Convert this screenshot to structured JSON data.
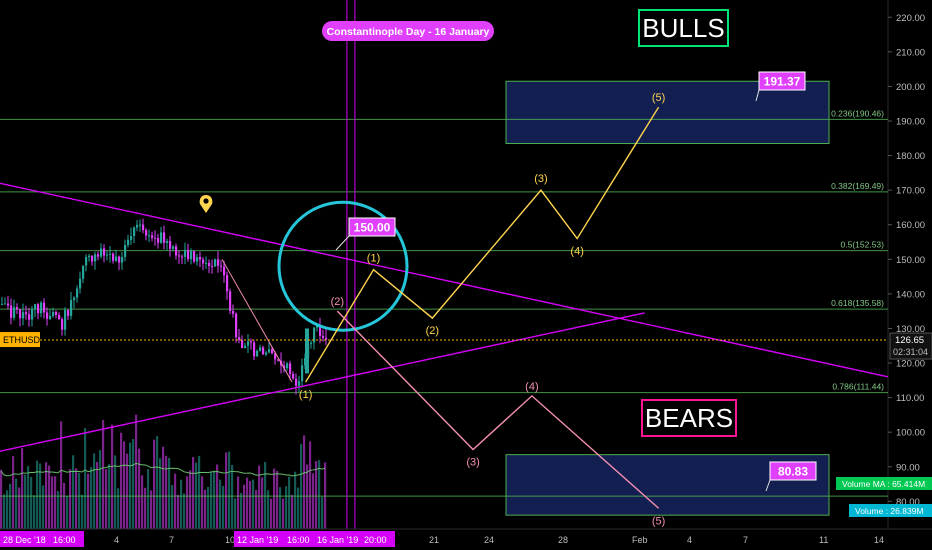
{
  "chart_data": {
    "type": "candlestick",
    "symbol": "ETHUSD",
    "y_axis": {
      "min": 72,
      "max": 225,
      "ticks": [
        80,
        90,
        100,
        110,
        120,
        130,
        140,
        150,
        160,
        170,
        180,
        190,
        200,
        210,
        220
      ],
      "tick_labels": [
        "80.00",
        "90.00",
        "100.00",
        "110.00",
        "120.00",
        "130.00",
        "140.00",
        "150.00",
        "160.00",
        "170.00",
        "180.00",
        "190.00",
        "200.00",
        "210.00",
        "220.00"
      ]
    },
    "x_axis": {
      "labels": [
        {
          "text": "28 Dec '18",
          "at": "2018-12-28",
          "highlight": true
        },
        {
          "text": "16:00",
          "at": "2018-12-28T16:00",
          "highlight": true
        },
        {
          "text": "4",
          "at": "2019-01-04",
          "highlight": false
        },
        {
          "text": "7",
          "at": "2019-01-07",
          "highlight": false
        },
        {
          "text": "10",
          "at": "2019-01-10",
          "highlight": false
        },
        {
          "text": "12 Jan '19",
          "at": "2019-01-12",
          "highlight": true
        },
        {
          "text": "16:00",
          "at": "2019-01-13T16:00",
          "highlight": true
        },
        {
          "text": "16 Jan '19",
          "at": "2019-01-16",
          "highlight": true
        },
        {
          "text": "20:00",
          "at": "2019-01-16T20:00",
          "highlight": true
        },
        {
          "text": "21",
          "at": "2019-01-21",
          "highlight": false
        },
        {
          "text": "24",
          "at": "2019-01-24",
          "highlight": false
        },
        {
          "text": "28",
          "at": "2019-01-28",
          "highlight": false
        },
        {
          "text": "Feb",
          "at": "2019-02-01",
          "highlight": false
        },
        {
          "text": "4",
          "at": "2019-02-04",
          "highlight": false
        },
        {
          "text": "7",
          "at": "2019-02-07",
          "highlight": false
        },
        {
          "text": "11",
          "at": "2019-02-11",
          "highlight": false
        },
        {
          "text": "14",
          "at": "2019-02-14",
          "highlight": false
        }
      ]
    },
    "fib_levels": [
      {
        "label": "0.236(190.46)",
        "value": 190.46
      },
      {
        "label": "0.382(169.49)",
        "value": 169.49
      },
      {
        "label": "0.5(152.53)",
        "value": 152.53
      },
      {
        "label": "0.618(135.58)",
        "value": 135.58
      },
      {
        "label": "0.786(111.44)",
        "value": 111.44
      },
      {
        "label": "",
        "value": 81.5
      }
    ],
    "current_price": {
      "value": 126.65,
      "label": "126.65",
      "countdown": "02:31:04"
    },
    "event": {
      "label": "Constantinople Day - 16 January",
      "at": "2019-01-16"
    },
    "targets": [
      {
        "label": "150.00",
        "value": 150.0
      },
      {
        "label": "191.37",
        "value": 191.37
      },
      {
        "label": "80.83",
        "value": 80.83
      }
    ],
    "scenario_labels": {
      "bull": "BULLS",
      "bear": "BEARS"
    },
    "bull_path": [
      {
        "at": "2019-01-13T12:00",
        "value": 114.5,
        "label": "(1)"
      },
      {
        "at": "2019-01-17T06:00",
        "value": 147.0,
        "label": "(1)"
      },
      {
        "at": "2019-01-20T12:00",
        "value": 133.0,
        "label": "(2)"
      },
      {
        "at": "2019-01-26T12:00",
        "value": 170.0,
        "label": "(3)"
      },
      {
        "at": "2019-01-28T12:00",
        "value": 156.0,
        "label": "(4)"
      },
      {
        "at": "2019-02-02T00:00",
        "value": 194.0,
        "label": "(5)"
      }
    ],
    "bear_path": [
      {
        "at": "2019-01-15T06:00",
        "value": 135.0,
        "label": "(2)"
      },
      {
        "at": "2019-01-22T18:00",
        "value": 95.0,
        "label": "(3)"
      },
      {
        "at": "2019-01-26T00:00",
        "value": 110.5,
        "label": "(4)"
      },
      {
        "at": "2019-02-02T00:00",
        "value": 78.0,
        "label": "(5)"
      }
    ],
    "trendlines": [
      {
        "name": "descending",
        "from": {
          "at": "2018-12-28",
          "value": 172
        },
        "to": {
          "at": "2019-02-14",
          "value": 116
        }
      },
      {
        "name": "ascending",
        "from": {
          "at": "2018-12-28",
          "value": 94.5
        },
        "to": {
          "at": "2019-02-01",
          "value": 134.5
        }
      }
    ],
    "volume": {
      "ma_label": "Volume MA",
      "ma_value": "65.414M",
      "label": "Volume",
      "value": "26.839M"
    },
    "colors": {
      "bull_candle": "#26a69a",
      "bear_candle": "#e040fb",
      "fib": "#4caf50",
      "trendline": "#d500f9",
      "bull_path": "#ffd54f",
      "bear_path": "#f48fb1",
      "circle": "#26c6da",
      "target_box": "#e040fb",
      "price_line": "#ffb300"
    }
  }
}
